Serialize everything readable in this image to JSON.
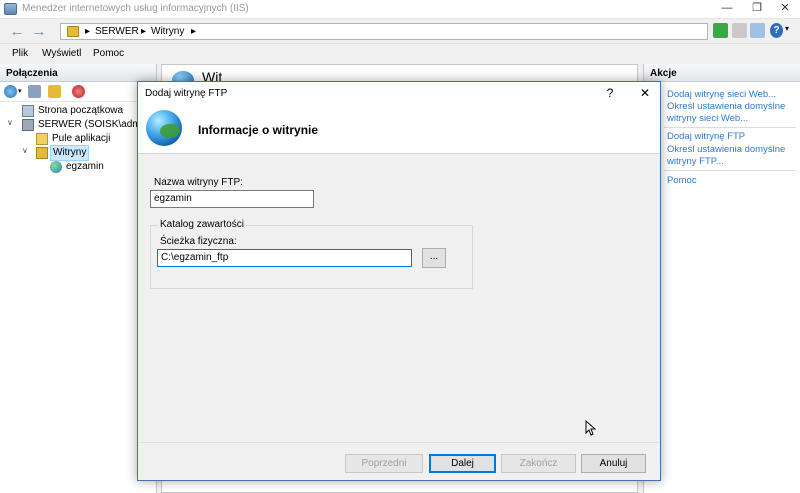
{
  "window": {
    "title": "Menedżer internetowych usług informacyjnych (IIS)",
    "minimize": "—",
    "restore": "❐",
    "close": "✕"
  },
  "nav": {
    "back_icon": "back-arrow-icon",
    "forward_icon": "forward-arrow-icon",
    "breadcrumb": [
      "SERWER",
      "Witryny"
    ],
    "separator": "▸",
    "help_label": "?"
  },
  "menu": [
    "Plik",
    "Wyświetl",
    "Pomoc"
  ],
  "connections": {
    "header": "Połączenia",
    "tree": [
      {
        "label": "Strona początkowa",
        "icon": "start-page-icon"
      },
      {
        "label": "SERWER (SOISK\\administ",
        "icon": "server-icon"
      },
      {
        "label": "Pule aplikacji",
        "icon": "app-pools-icon"
      },
      {
        "label": "Witryny",
        "icon": "sites-folder-icon"
      },
      {
        "label": "egzamin",
        "icon": "globe-icon"
      }
    ]
  },
  "center": {
    "peek_text": "Wit"
  },
  "actions": {
    "header": "Akcje",
    "items": [
      "Dodaj witrynę sieci Web...",
      "Określ ustawienia domyślne witryny sieci Web...",
      "Dodaj witrynę FTP",
      "Określ ustawienia domyślne witryny FTP...",
      "Pomoc"
    ]
  },
  "dialog": {
    "title": "Dodaj witrynę FTP",
    "help": "?",
    "close": "✕",
    "header": "Informacje o witrynie",
    "site_name_label": "Nazwa witryny FTP:",
    "site_name_value": "egzamin",
    "group_title": "Katalog zawartości",
    "path_label": "Ścieżka fizyczna:",
    "path_value": "C:\\egzamin_ftp",
    "browse": "...",
    "buttons": {
      "previous": "Poprzedni",
      "next": "Dalej",
      "finish": "Zakończ",
      "cancel": "Anuluj"
    }
  },
  "colors": {
    "link": "#3079c6",
    "accent": "#0078d7",
    "selection": "#cce8ff"
  }
}
